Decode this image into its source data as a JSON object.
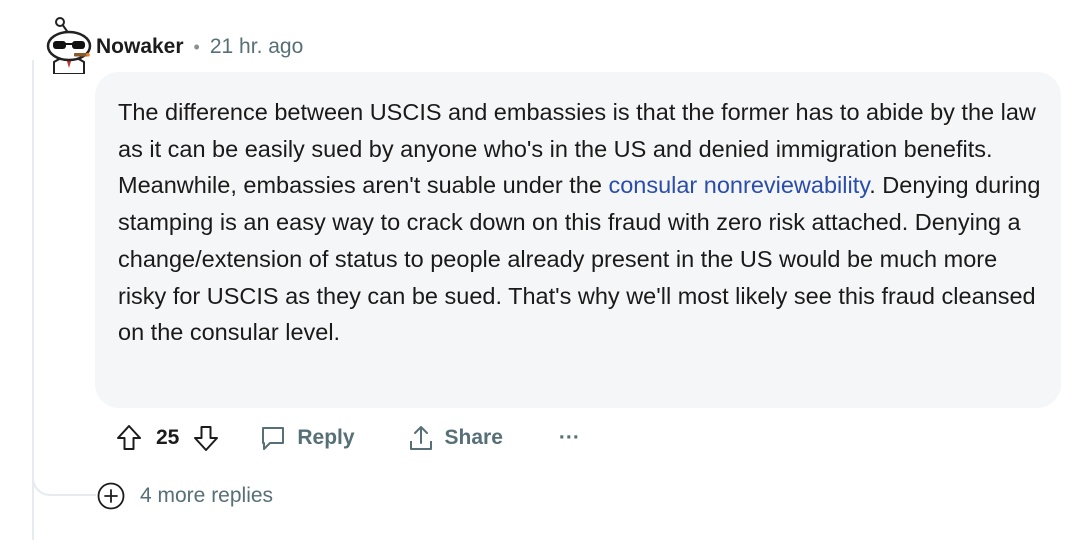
{
  "comment": {
    "username": "Nowaker",
    "separator": "•",
    "time": "21 hr. ago",
    "body_before_link": "The difference between USCIS and embassies is that the former has to abide by the law as it can be easily sued by anyone who's in the US and denied immigration benefits. Meanwhile, embassies aren't suable under the ",
    "link_text": "consular nonreviewability",
    "body_after_link": ". Denying during stamping is an easy way to crack down on this fraud with zero risk attached. Denying a change/extension of status to people already present in the US would be much more risky for USCIS as they can be sued. That's why we'll most likely see this fraud cleansed on the consular level.",
    "score": "25",
    "reply_label": "Reply",
    "share_label": "Share",
    "more_label": "···",
    "more_replies": "4 more replies"
  },
  "colors": {
    "link": "#2a4dac",
    "meta": "#576f76",
    "bubble": "#f5f6f7"
  },
  "icons": {
    "upvote": "upvote-arrow-icon",
    "downvote": "downvote-arrow-icon",
    "reply": "speech-bubble-icon",
    "share": "share-upload-icon",
    "more": "ellipsis-icon",
    "expand": "plus-circle-icon"
  }
}
